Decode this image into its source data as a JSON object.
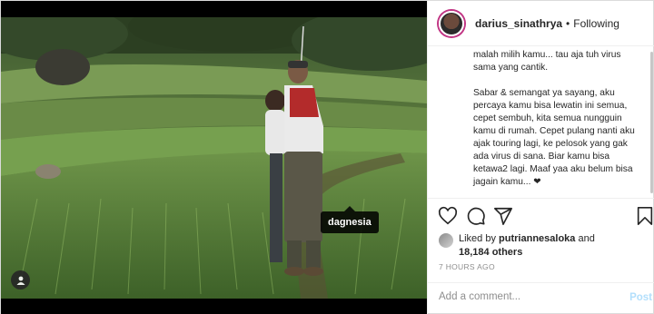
{
  "post": {
    "tag": "dagnesia"
  },
  "header": {
    "username": "darius_sinathrya",
    "separator": "•",
    "follow_label": "Following"
  },
  "caption": {
    "line1": "malah milih kamu... tau aja tuh virus sama yang cantik.",
    "line2": "Sabar & semangat ya sayang, aku percaya kamu bisa lewatin ini semua, cepet sembuh, kita semua nungguin kamu di rumah. Cepet pulang nanti aku ajak touring lagi, ke pelosok yang gak ada virus di sana. Biar kamu bisa ketawa2 lagi. Maaf yaa aku belum bisa jagain kamu... ❤"
  },
  "likes": {
    "prefix": "Liked by",
    "user": "putriannesaloka",
    "and": "and",
    "count": "18,184 others"
  },
  "timestamp": "7 HOURS AGO",
  "comment": {
    "placeholder": "Add a comment...",
    "post_label": "Post"
  },
  "icons": [
    "user-tag-icon",
    "heart-icon",
    "comment-icon",
    "share-icon",
    "bookmark-icon"
  ],
  "colors": {
    "post_button": "#b2dffc",
    "story_ring": "#c13584"
  }
}
